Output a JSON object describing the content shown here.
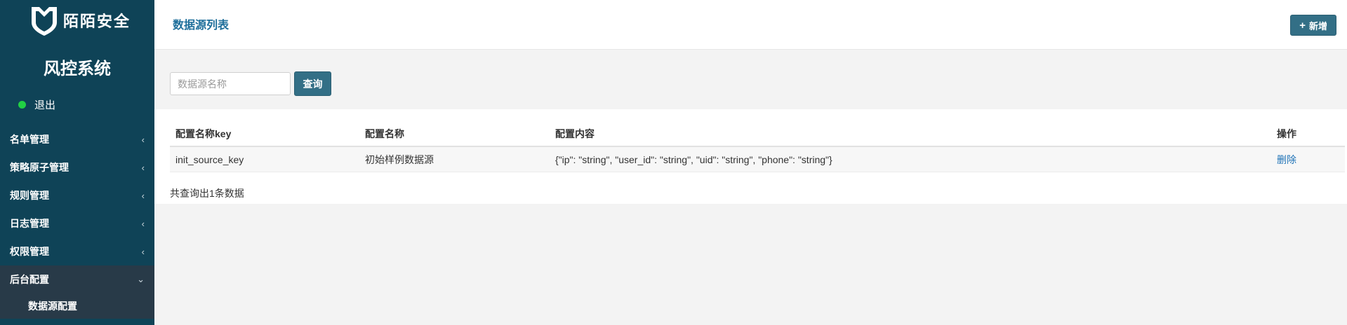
{
  "brand": {
    "name": "陌陌安全",
    "logo_icon": "shield-logo-icon"
  },
  "system_title": "风控系统",
  "logout": {
    "label": "退出",
    "status_color": "#21d044"
  },
  "menu": {
    "items": [
      {
        "label": "名单管理",
        "icon": "chevron-left-icon"
      },
      {
        "label": "策略原子管理",
        "icon": "chevron-left-icon"
      },
      {
        "label": "规则管理",
        "icon": "chevron-left-icon"
      },
      {
        "label": "日志管理",
        "icon": "chevron-left-icon"
      },
      {
        "label": "权限管理",
        "icon": "chevron-left-icon"
      }
    ],
    "expanded": {
      "label": "后台配置",
      "icon": "chevron-down-icon",
      "subitems": [
        {
          "label": "数据源配置"
        }
      ]
    }
  },
  "header": {
    "title": "数据源列表",
    "add_button": {
      "icon": "+",
      "label": "新增"
    }
  },
  "search": {
    "placeholder": "数据源名称",
    "value": "",
    "button_label": "查询"
  },
  "table": {
    "columns": [
      "配置名称key",
      "配置名称",
      "配置内容",
      "操作"
    ],
    "rows": [
      {
        "key": "init_source_key",
        "name": "初始样例数据源",
        "content": "{\"ip\": \"string\", \"user_id\": \"string\", \"uid\": \"string\", \"phone\": \"string\"}",
        "action": "删除"
      }
    ]
  },
  "summary": "共查询出1条数据",
  "colors": {
    "sidebar_bg": "#0f4357",
    "submenu_bg": "#283a48",
    "accent": "#336f86",
    "title": "#1f6f9b",
    "link": "#1f73b7"
  }
}
